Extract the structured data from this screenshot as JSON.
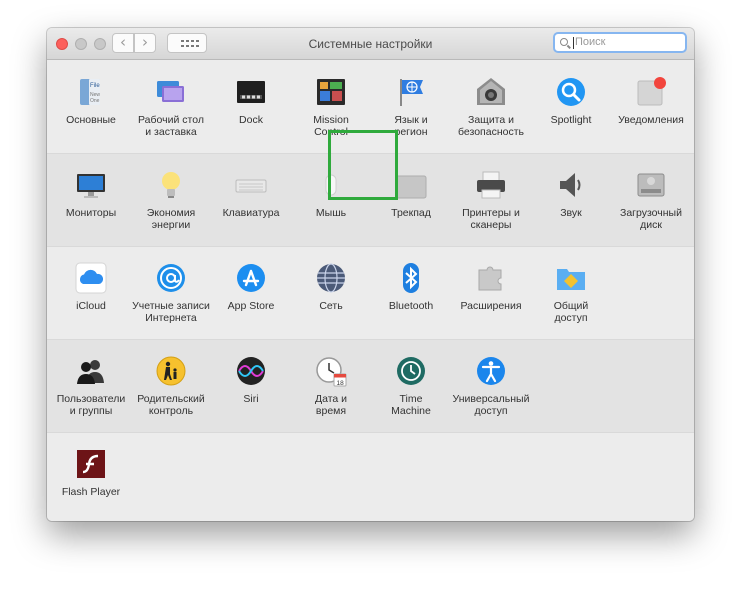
{
  "window": {
    "title": "Системные настройки"
  },
  "toolbar": {
    "back_glyph": "‹",
    "forward_glyph": "›",
    "search_placeholder": "Поиск"
  },
  "rows": [
    {
      "panes": [
        {
          "id": "general",
          "label": "Основные",
          "icon": "general-icon"
        },
        {
          "id": "desktop",
          "label": "Рабочий стол\nи заставка",
          "icon": "desktop-screensaver-icon"
        },
        {
          "id": "dock",
          "label": "Dock",
          "icon": "dock-icon"
        },
        {
          "id": "mission",
          "label": "Mission\nControl",
          "icon": "mission-control-icon"
        },
        {
          "id": "language",
          "label": "Язык и\nрегион",
          "icon": "language-region-icon"
        },
        {
          "id": "security",
          "label": "Защита и\nбезопасность",
          "icon": "security-icon"
        },
        {
          "id": "spotlight",
          "label": "Spotlight",
          "icon": "spotlight-icon"
        },
        {
          "id": "notifications",
          "label": "Уведомления",
          "icon": "notifications-icon"
        }
      ]
    },
    {
      "panes": [
        {
          "id": "displays",
          "label": "Мониторы",
          "icon": "displays-icon"
        },
        {
          "id": "energy",
          "label": "Экономия\nэнергии",
          "icon": "energy-saver-icon"
        },
        {
          "id": "keyboard",
          "label": "Клавиатура",
          "icon": "keyboard-icon"
        },
        {
          "id": "mouse",
          "label": "Мышь",
          "icon": "mouse-icon"
        },
        {
          "id": "trackpad",
          "label": "Трекпад",
          "icon": "trackpad-icon"
        },
        {
          "id": "printers",
          "label": "Принтеры и\nсканеры",
          "icon": "printer-icon"
        },
        {
          "id": "sound",
          "label": "Звук",
          "icon": "sound-icon"
        },
        {
          "id": "startup",
          "label": "Загрузочный\nдиск",
          "icon": "startup-disk-icon"
        }
      ]
    },
    {
      "panes": [
        {
          "id": "icloud",
          "label": "iCloud",
          "icon": "icloud-icon"
        },
        {
          "id": "internet",
          "label": "Учетные записи\nИнтернета",
          "icon": "internet-accounts-icon"
        },
        {
          "id": "appstore",
          "label": "App Store",
          "icon": "app-store-icon"
        },
        {
          "id": "network",
          "label": "Сеть",
          "icon": "network-icon"
        },
        {
          "id": "bluetooth",
          "label": "Bluetooth",
          "icon": "bluetooth-icon"
        },
        {
          "id": "extensions",
          "label": "Расширения",
          "icon": "extensions-icon"
        },
        {
          "id": "sharing",
          "label": "Общий\nдоступ",
          "icon": "sharing-icon"
        }
      ]
    },
    {
      "panes": [
        {
          "id": "users",
          "label": "Пользователи\nи группы",
          "icon": "users-groups-icon"
        },
        {
          "id": "parental",
          "label": "Родительский\nконтроль",
          "icon": "parental-controls-icon"
        },
        {
          "id": "siri",
          "label": "Siri",
          "icon": "siri-icon"
        },
        {
          "id": "datetime",
          "label": "Дата и\nвремя",
          "icon": "date-time-icon"
        },
        {
          "id": "timemachine",
          "label": "Time\nMachine",
          "icon": "time-machine-icon"
        },
        {
          "id": "accessibility",
          "label": "Универсальный\nдоступ",
          "icon": "accessibility-icon"
        }
      ]
    },
    {
      "panes": [
        {
          "id": "flash",
          "label": "Flash Player",
          "icon": "flash-player-icon"
        }
      ]
    }
  ],
  "icon_text": {
    "general_file": "File",
    "general_new": "New",
    "general_one": "One",
    "calendar_day": "18"
  },
  "highlighted_pane": "trackpad",
  "colors": {
    "highlight": "#2faa3c",
    "close_button": "#fc605c",
    "search_focus": "#86b6f0"
  }
}
